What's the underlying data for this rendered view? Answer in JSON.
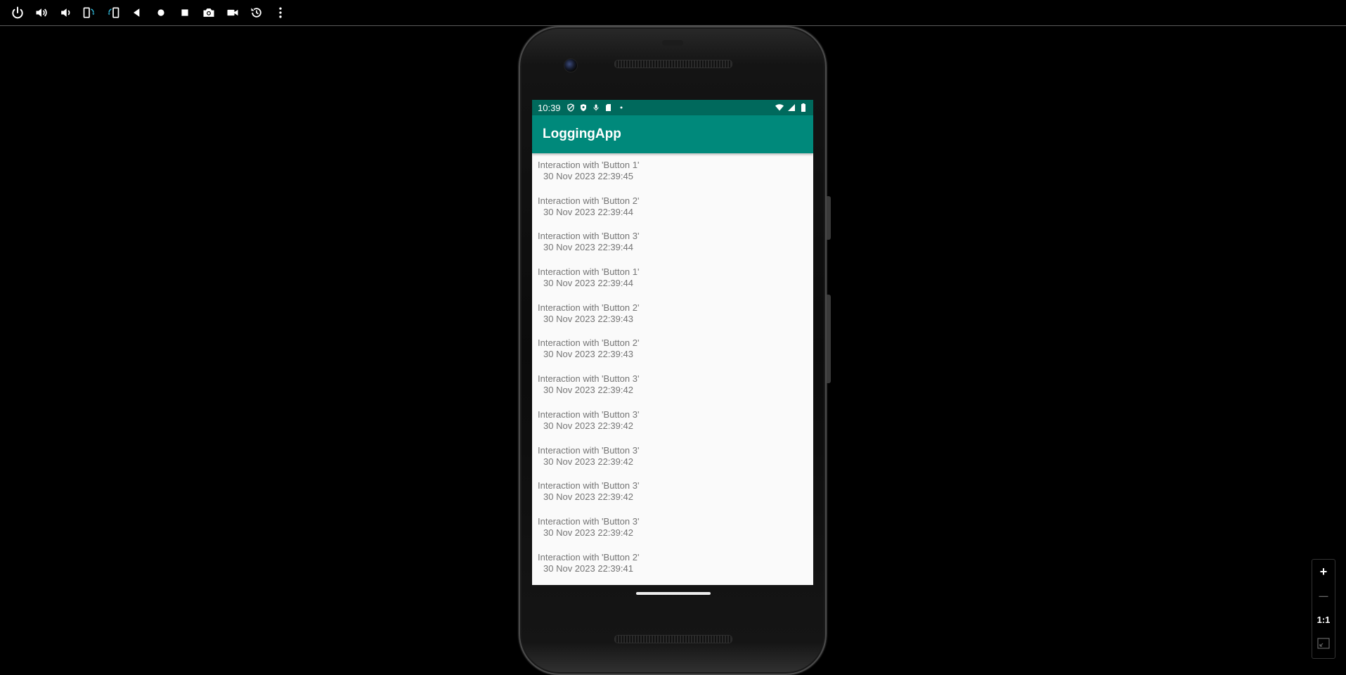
{
  "toolbar": {
    "buttons": [
      {
        "name": "power-icon"
      },
      {
        "name": "volume-up-icon"
      },
      {
        "name": "volume-down-icon"
      },
      {
        "name": "rotate-left-icon"
      },
      {
        "name": "rotate-right-icon"
      },
      {
        "name": "back-icon"
      },
      {
        "name": "home-icon"
      },
      {
        "name": "overview-icon"
      },
      {
        "name": "camera-icon"
      },
      {
        "name": "screenrecord-icon"
      },
      {
        "name": "reset-icon"
      },
      {
        "name": "more-icon"
      }
    ],
    "accent_color": "#2fb3d3"
  },
  "status_bar": {
    "time": "10:39",
    "color": "#00695c"
  },
  "app_bar": {
    "title": "LoggingApp",
    "color": "#00897b"
  },
  "log": {
    "items": [
      {
        "text": "Interaction with 'Button 1'",
        "timestamp": "30 Nov 2023 22:39:45"
      },
      {
        "text": "Interaction with 'Button 2'",
        "timestamp": "30 Nov 2023 22:39:44"
      },
      {
        "text": "Interaction with 'Button 3'",
        "timestamp": "30 Nov 2023 22:39:44"
      },
      {
        "text": "Interaction with 'Button 1'",
        "timestamp": "30 Nov 2023 22:39:44"
      },
      {
        "text": "Interaction with 'Button 2'",
        "timestamp": "30 Nov 2023 22:39:43"
      },
      {
        "text": "Interaction with 'Button 2'",
        "timestamp": "30 Nov 2023 22:39:43"
      },
      {
        "text": "Interaction with 'Button 3'",
        "timestamp": "30 Nov 2023 22:39:42"
      },
      {
        "text": "Interaction with 'Button 3'",
        "timestamp": "30 Nov 2023 22:39:42"
      },
      {
        "text": "Interaction with 'Button 3'",
        "timestamp": "30 Nov 2023 22:39:42"
      },
      {
        "text": "Interaction with 'Button 3'",
        "timestamp": "30 Nov 2023 22:39:42"
      },
      {
        "text": "Interaction with 'Button 3'",
        "timestamp": "30 Nov 2023 22:39:42"
      },
      {
        "text": "Interaction with 'Button 2'",
        "timestamp": "30 Nov 2023 22:39:41"
      }
    ]
  },
  "zoom_panel": {
    "zoom_in": "+",
    "zoom_out": "—",
    "actual_size": "1:1"
  }
}
